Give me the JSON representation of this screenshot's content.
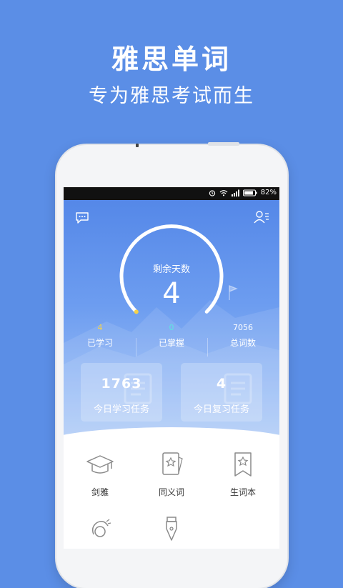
{
  "promo": {
    "title": "雅思单词",
    "subtitle": "专为雅思考试而生"
  },
  "statusbar": {
    "battery": "82%"
  },
  "gauge": {
    "label": "剩余天数",
    "value": "4"
  },
  "stats": [
    {
      "value": "4",
      "label": "已学习",
      "color": "#f5d24a"
    },
    {
      "value": "0",
      "label": "已掌握",
      "color": "#5fe3e0"
    },
    {
      "value": "7056",
      "label": "总词数",
      "color": "#ffffff"
    }
  ],
  "tasks": [
    {
      "value": "1763",
      "label": "今日学习任务"
    },
    {
      "value": "4",
      "label": "今日复习任务"
    }
  ],
  "features": [
    {
      "label": "剑雅",
      "icon": "graduation-cap-icon"
    },
    {
      "label": "同义词",
      "icon": "star-card-icon"
    },
    {
      "label": "生词本",
      "icon": "bookmark-star-icon"
    },
    {
      "label": "",
      "icon": "ear-icon"
    },
    {
      "label": "",
      "icon": "pen-nib-icon"
    }
  ],
  "colors": {
    "background": "#5b8ee6",
    "hero_top": "#5588e8",
    "accent_yellow": "#f5d24a",
    "accent_cyan": "#5fe3e0"
  }
}
